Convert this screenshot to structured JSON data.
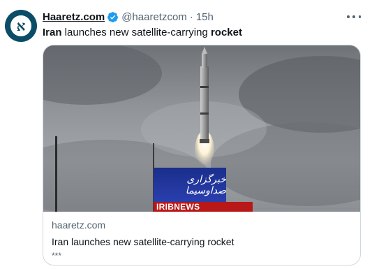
{
  "tweet": {
    "author_name": "Haaretz.com",
    "handle": "@haaretzcom",
    "separator": "·",
    "time": "15h",
    "text_prefix": "Iran",
    "text_middle": " launches new satellite-carrying ",
    "text_suffix": "rocket",
    "avatar_glyph": "א"
  },
  "card": {
    "overlay_banner": "خبرگزاری صداوسیما",
    "overlay_label": "IRIBNEWS",
    "domain": "haaretz.com",
    "title": "Iran launches new satellite-carrying rocket",
    "description": "***"
  },
  "icons": {
    "verified": "verified-badge-icon",
    "more": "more-options-icon"
  },
  "colors": {
    "verified_blue": "#1d9bf0",
    "avatar_bg": "#0b4d66",
    "secondary_text": "#536471",
    "banner_blue": "#1f33a0",
    "label_red": "#b81818"
  }
}
